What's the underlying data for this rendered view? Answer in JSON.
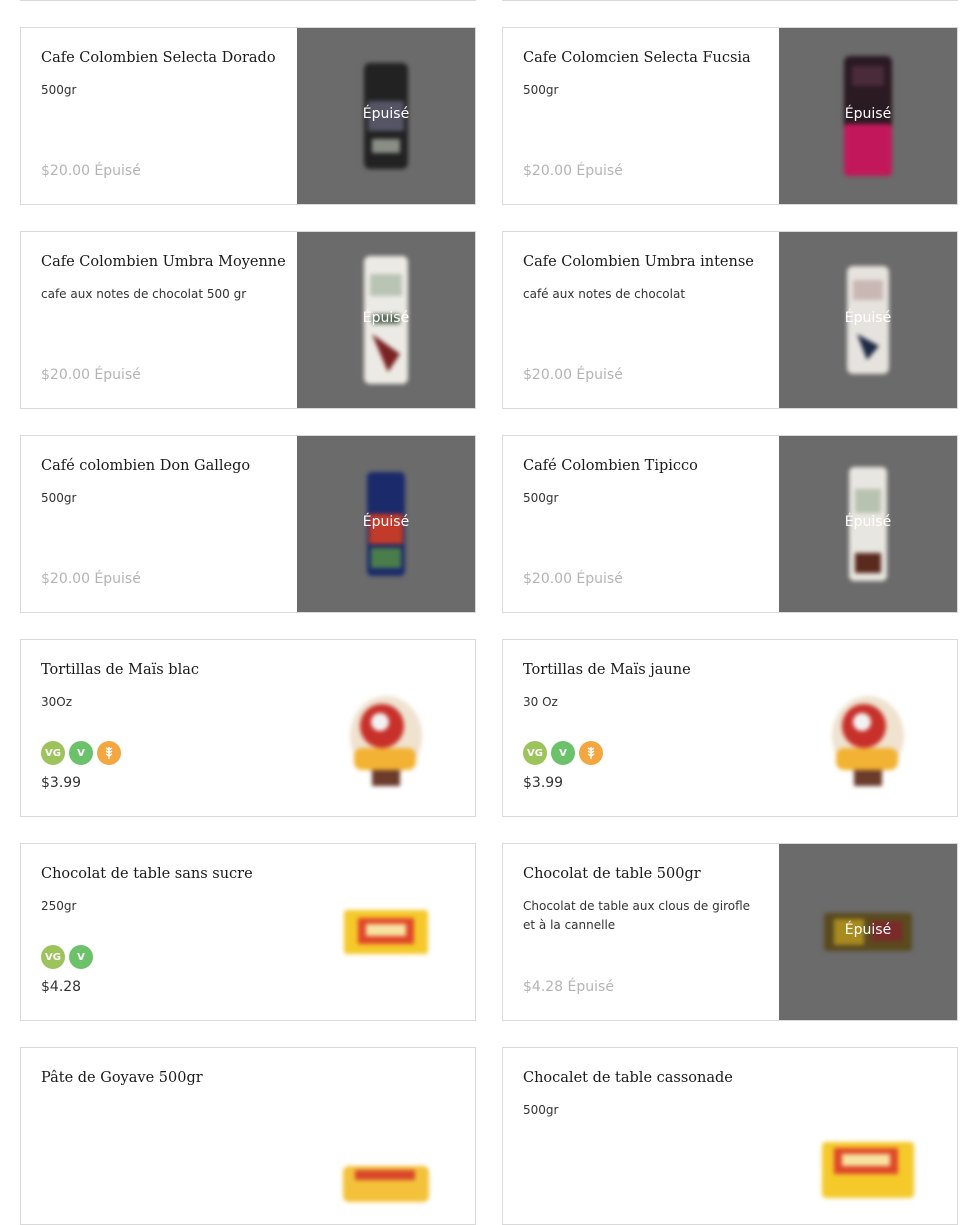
{
  "colors": {
    "border": "#d9d9d9",
    "soldout_overlay": "#6b6b6b",
    "badge_vg": "#9cc35c",
    "badge_v": "#6bc26b",
    "badge_gf": "#f4a640"
  },
  "products": [
    {
      "title": "Cafe Colombien Selecta Dorado",
      "desc": "500gr",
      "price": "$20.00 Épuisé",
      "soldout_label": "Épuisé"
    },
    {
      "title": "Cafe Colomcien Selecta Fucsia",
      "desc": "500gr",
      "price": "$20.00 Épuisé",
      "soldout_label": "Épuisé"
    },
    {
      "title": "Cafe Colombien Umbra Moyenne",
      "desc": "cafe aux notes de chocolat 500 gr",
      "price": "$20.00 Épuisé",
      "soldout_label": "Épuisé"
    },
    {
      "title": "Cafe Colombien Umbra intense",
      "desc": "café aux notes de chocolat",
      "price": "$20.00 Épuisé",
      "soldout_label": "Épuisé"
    },
    {
      "title": "Café colombien Don Gallego",
      "desc": "500gr",
      "price": "$20.00 Épuisé",
      "soldout_label": "Épuisé"
    },
    {
      "title": "Café Colombien Tipicco",
      "desc": "500gr",
      "price": "$20.00 Épuisé",
      "soldout_label": "Épuisé"
    },
    {
      "title": "Tortillas de Maïs blac",
      "desc": "30Oz",
      "price": "$3.99",
      "badges": [
        "VG",
        "V",
        "gluten-free-icon"
      ]
    },
    {
      "title": "Tortillas de Maïs jaune",
      "desc": "30 Oz",
      "price": "$3.99",
      "badges": [
        "VG",
        "V",
        "gluten-free-icon"
      ]
    },
    {
      "title": "Chocolat de table sans sucre",
      "desc": "250gr",
      "price": "$4.28",
      "badges": [
        "VG",
        "V"
      ]
    },
    {
      "title": "Chocolat de table 500gr",
      "desc": "Chocolat de table aux clous de girofle et à la cannelle",
      "price": "$4.28 Épuisé",
      "soldout_label": "Épuisé"
    },
    {
      "title": "Pâte de Goyave 500gr",
      "desc": ""
    },
    {
      "title": "Chocalet de table cassonade",
      "desc": "500gr"
    }
  ]
}
